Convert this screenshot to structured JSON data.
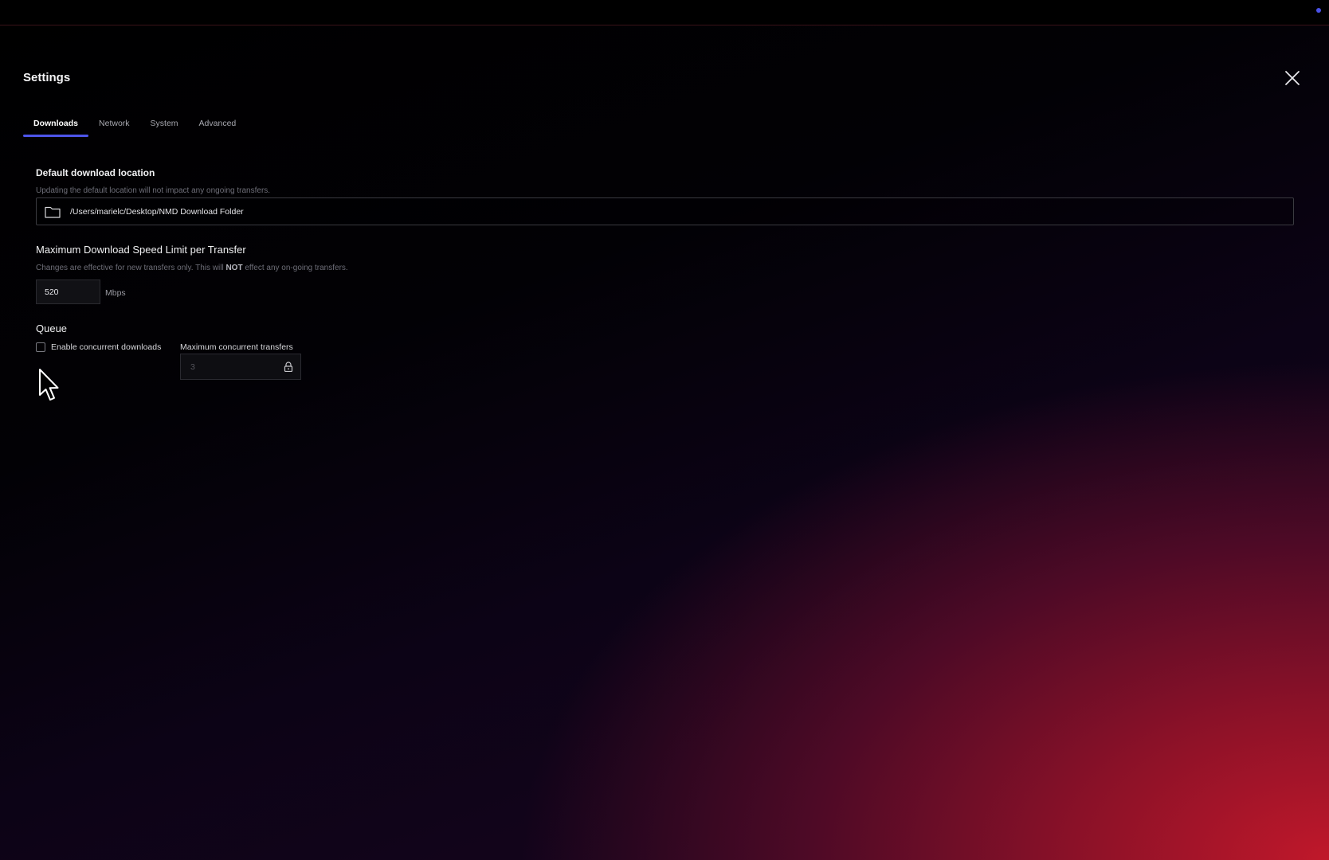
{
  "window": {
    "title": "Settings"
  },
  "tabs": [
    {
      "label": "Downloads",
      "active": true
    },
    {
      "label": "Network",
      "active": false
    },
    {
      "label": "System",
      "active": false
    },
    {
      "label": "Advanced",
      "active": false
    }
  ],
  "download_location": {
    "label": "Default download location",
    "help": "Updating the default location will not impact any ongoing transfers.",
    "path": "/Users/marielc/Desktop/NMD Download Folder",
    "icon": "folder-icon"
  },
  "speed_limit": {
    "label": "Maximum Download Speed Limit per Transfer",
    "help_before": "Changes are effective for new transfers only. This will ",
    "help_bold": "NOT",
    "help_after": " effect any on-going transfers.",
    "value": "520",
    "unit": "Mbps"
  },
  "queue": {
    "label": "Queue",
    "concurrent_label": "Enable concurrent downloads",
    "concurrent_checked": false,
    "max_label": "Maximum concurrent transfers",
    "max_value": "3",
    "max_locked": true,
    "lock_icon": "lock-icon"
  },
  "colors": {
    "accent": "#4d55ea",
    "status_dot": "#4a52e8",
    "gradient_red": "#c0182a"
  }
}
